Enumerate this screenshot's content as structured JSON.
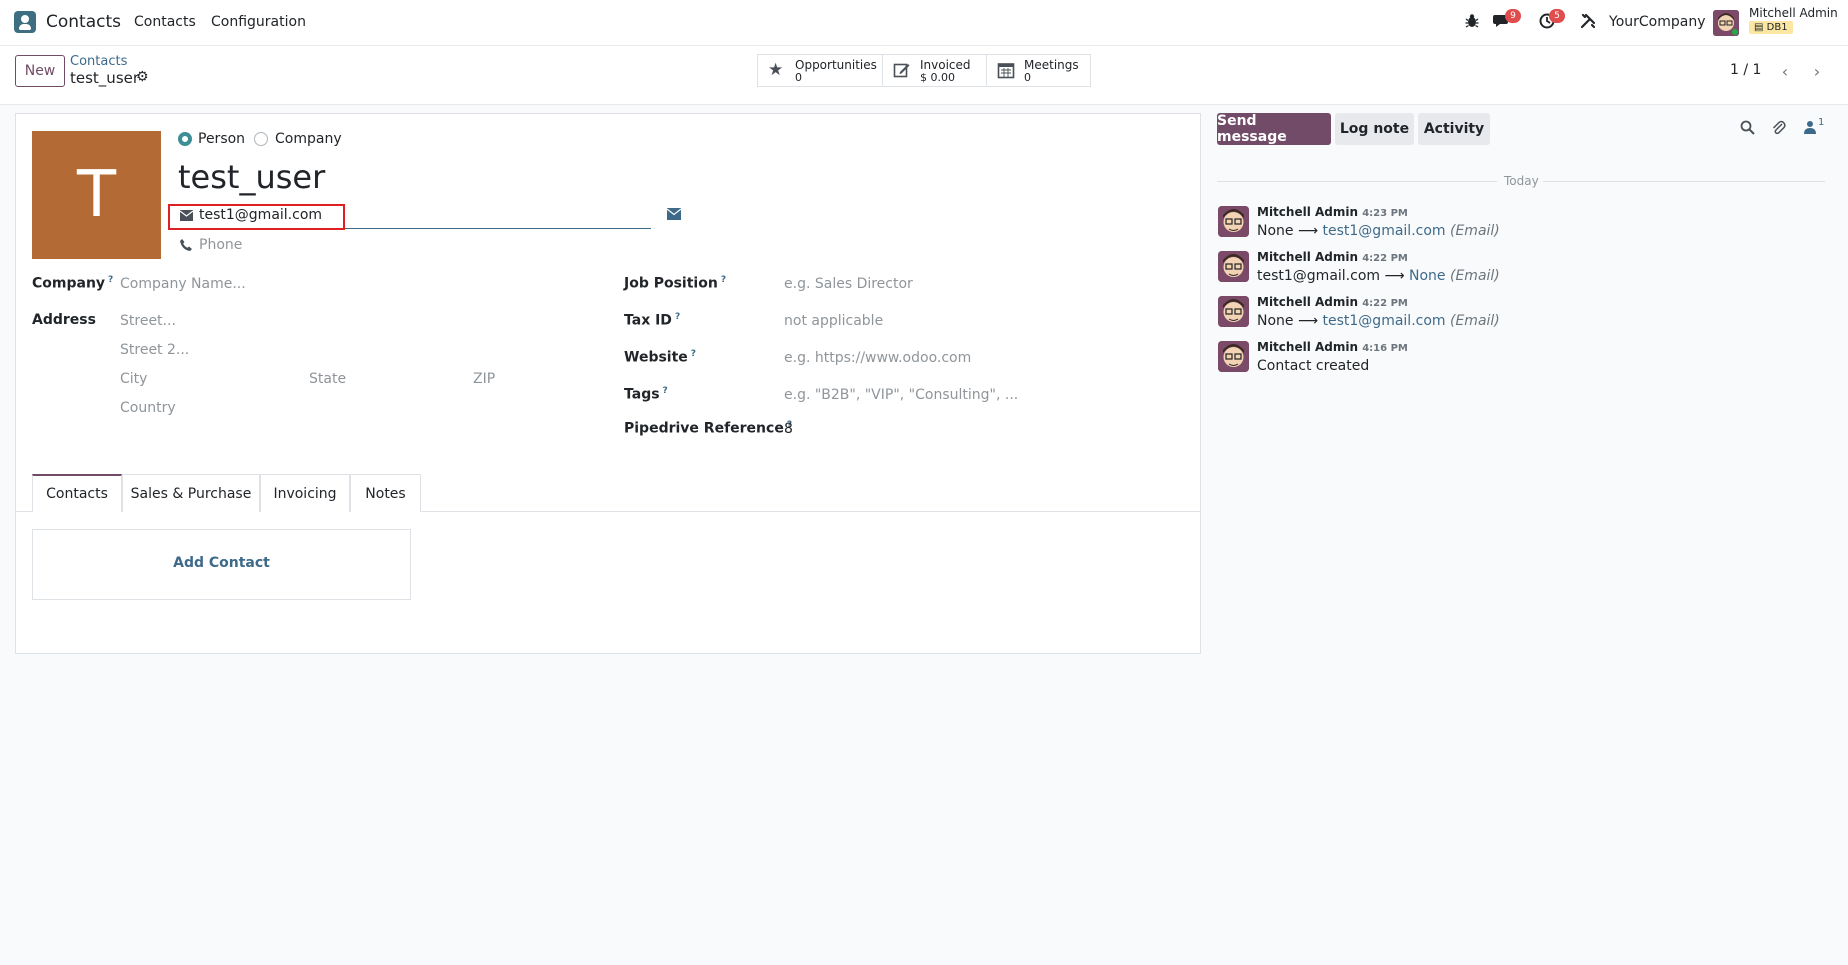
{
  "navbar": {
    "app_name": "Contacts",
    "menu": [
      "Contacts",
      "Configuration"
    ],
    "chat_badge": "9",
    "activity_badge": "5",
    "company": "YourCompany",
    "user": "Mitchell Admin",
    "db": "DB1"
  },
  "control": {
    "new_label": "New",
    "breadcrumb_parent": "Contacts",
    "breadcrumb_current": "test_user",
    "smart_buttons": [
      {
        "label": "Opportunities",
        "value": "0",
        "icon": "star-icon"
      },
      {
        "label": "Invoiced",
        "value": "$ 0.00",
        "icon": "edit-icon"
      },
      {
        "label": "Meetings",
        "value": "0",
        "icon": "calendar-icon"
      }
    ],
    "pager": "1 / 1"
  },
  "form": {
    "avatar_letter": "T",
    "type_person": "Person",
    "type_company": "Company",
    "name": "test_user",
    "email": "test1@gmail.com",
    "phone_placeholder": "Phone",
    "left": {
      "company_label": "Company",
      "company_placeholder": "Company Name...",
      "address_label": "Address",
      "street_placeholder": "Street...",
      "street2_placeholder": "Street 2...",
      "city_placeholder": "City",
      "state_placeholder": "State",
      "zip_placeholder": "ZIP",
      "country_placeholder": "Country"
    },
    "right": {
      "job_label": "Job Position",
      "job_placeholder": "e.g. Sales Director",
      "tax_label": "Tax ID",
      "tax_value": "not applicable",
      "website_label": "Website",
      "website_placeholder": "e.g. https://www.odoo.com",
      "tags_label": "Tags",
      "tags_placeholder": "e.g. \"B2B\", \"VIP\", \"Consulting\", ...",
      "pipedrive_label": "Pipedrive Reference",
      "pipedrive_value": "8"
    },
    "tabs": [
      "Contacts",
      "Sales & Purchase",
      "Invoicing",
      "Notes"
    ],
    "add_contact": "Add Contact"
  },
  "chatter": {
    "send_message": "Send message",
    "log_note": "Log note",
    "activity": "Activity",
    "followers_count": "1",
    "today": "Today",
    "messages": [
      {
        "author": "Mitchell Admin",
        "time": "4:23 PM",
        "old": "None",
        "new": "test1@gmail.com",
        "field": "(Email)"
      },
      {
        "author": "Mitchell Admin",
        "time": "4:22 PM",
        "old": "test1@gmail.com",
        "new": "None",
        "field": "(Email)"
      },
      {
        "author": "Mitchell Admin",
        "time": "4:22 PM",
        "old": "None",
        "new": "test1@gmail.com",
        "field": "(Email)"
      },
      {
        "author": "Mitchell Admin",
        "time": "4:16 PM",
        "body": "Contact created"
      }
    ]
  }
}
